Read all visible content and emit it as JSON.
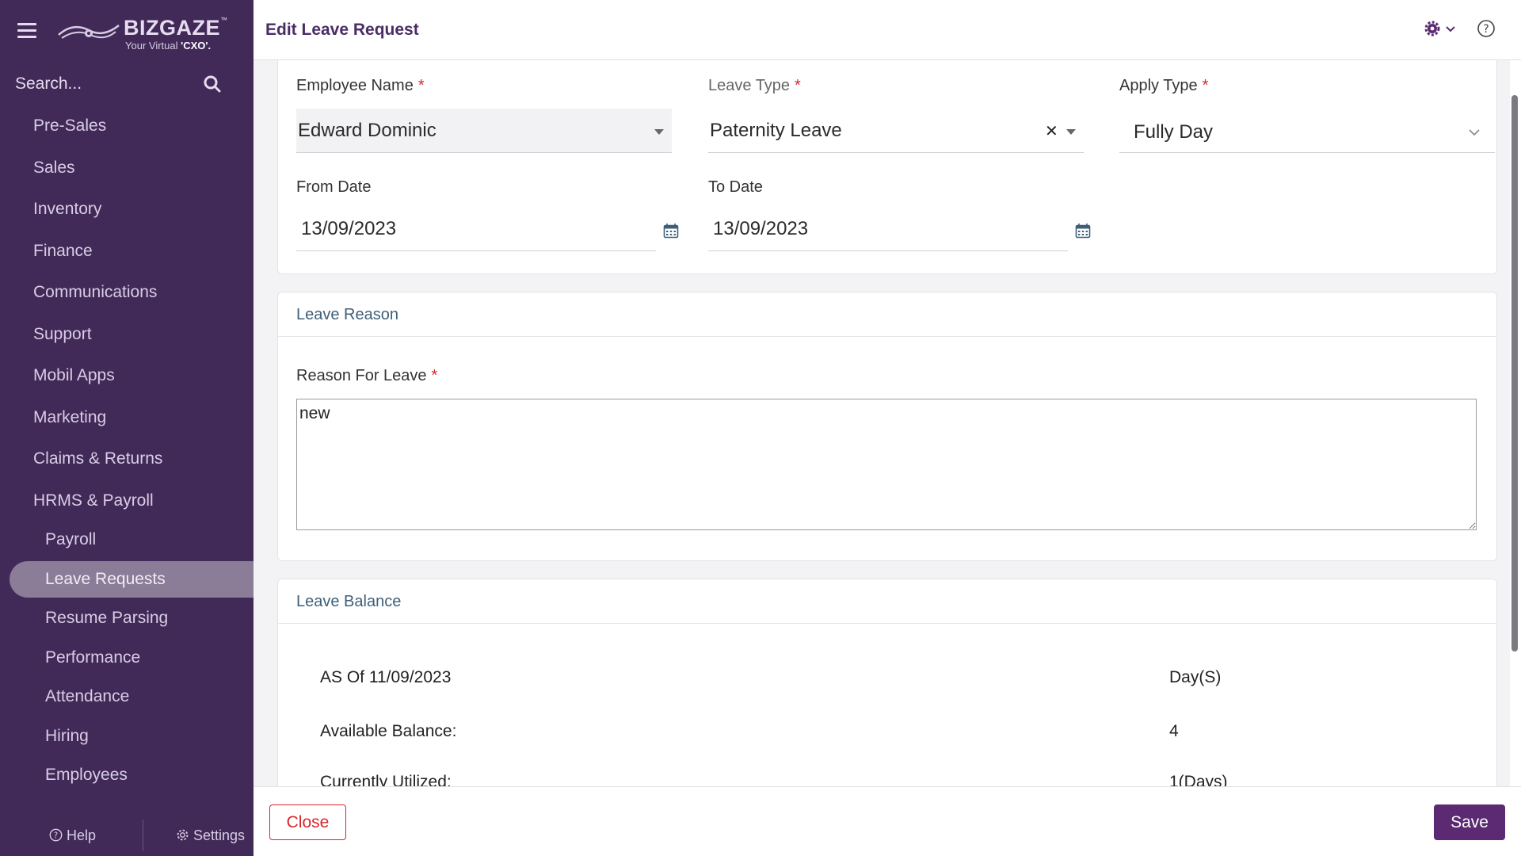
{
  "brand": {
    "name": "BIZGAZE",
    "tm": "™",
    "tagline_prefix": "Your Virtual ",
    "tagline_bold": "'CXO'."
  },
  "sidebar": {
    "search_placeholder": "Search...",
    "items": [
      {
        "label": "Pre-Sales",
        "level": "top"
      },
      {
        "label": "Sales",
        "level": "top"
      },
      {
        "label": "Inventory",
        "level": "top"
      },
      {
        "label": "Finance",
        "level": "top"
      },
      {
        "label": "Communications",
        "level": "top"
      },
      {
        "label": "Support",
        "level": "top"
      },
      {
        "label": "Mobil Apps",
        "level": "top"
      },
      {
        "label": "Marketing",
        "level": "top"
      },
      {
        "label": "Claims & Returns",
        "level": "top"
      },
      {
        "label": "HRMS & Payroll",
        "level": "top"
      },
      {
        "label": "Payroll",
        "level": "sub"
      },
      {
        "label": "Leave Requests",
        "level": "sub",
        "active": true
      },
      {
        "label": "Resume Parsing",
        "level": "sub"
      },
      {
        "label": "Performance",
        "level": "sub"
      },
      {
        "label": "Attendance",
        "level": "sub"
      },
      {
        "label": "Hiring",
        "level": "sub"
      },
      {
        "label": "Employees",
        "level": "sub"
      }
    ],
    "help_label": "Help",
    "settings_label": "Settings"
  },
  "header": {
    "title": "Edit Leave Request"
  },
  "form": {
    "employee_name": {
      "label": "Employee Name",
      "value": "Edward Dominic"
    },
    "leave_type": {
      "label": "Leave Type",
      "value": "Paternity Leave"
    },
    "apply_type": {
      "label": "Apply Type",
      "value": "Fully Day"
    },
    "from_date": {
      "label": "From Date",
      "value": "13/09/2023"
    },
    "to_date": {
      "label": "To Date",
      "value": "13/09/2023"
    },
    "required_mark": "*"
  },
  "leave_reason": {
    "section_title": "Leave Reason",
    "label": "Reason For Leave",
    "value": "new"
  },
  "leave_balance": {
    "section_title": "Leave Balance",
    "rows": [
      {
        "key": "AS Of 11/09/2023",
        "value": "Day(S)"
      },
      {
        "key": "Available Balance:",
        "value": "4"
      },
      {
        "key": "Currently Utilized:",
        "value": "1(Days)"
      }
    ]
  },
  "footer": {
    "close_label": "Close",
    "save_label": "Save"
  },
  "colors": {
    "sidebar_bg": "#422a58",
    "accent": "#5b2a72",
    "required": "#d9262c"
  }
}
